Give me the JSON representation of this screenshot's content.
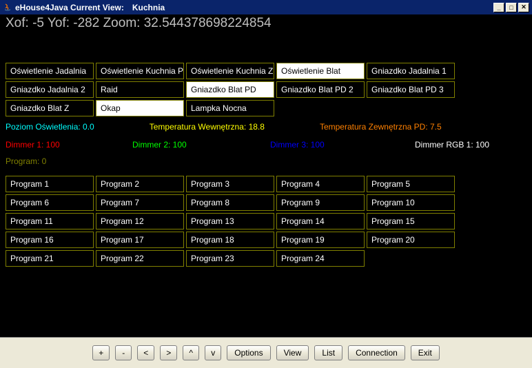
{
  "titlebar": {
    "app": "eHouse4Java Current View:",
    "view": "Kuchnia"
  },
  "coords": {
    "xof": -5,
    "yof": -282,
    "zoom": 32.544378698224854
  },
  "devices": [
    {
      "label": "Oświetlenie Jadalnia",
      "active": false
    },
    {
      "label": "Oświetlenie Kuchnia PD",
      "active": false
    },
    {
      "label": "Oświetlenie Kuchnia  Z",
      "active": false
    },
    {
      "label": "Oświetlenie Blat",
      "active": true
    },
    {
      "label": "Gniazdko Jadalnia 1",
      "active": false
    },
    {
      "label": "Gniazdko Jadalnia 2",
      "active": false
    },
    {
      "label": "Raid",
      "active": false
    },
    {
      "label": "Gniazdko Blat PD",
      "active": true
    },
    {
      "label": "Gniazdko Blat PD 2",
      "active": false
    },
    {
      "label": "Gniazdko Blat PD 3",
      "active": false
    },
    {
      "label": "Gniazdko Blat Z",
      "active": false
    },
    {
      "label": "Okap",
      "active": true
    },
    {
      "label": "Lampka Nocna",
      "active": false
    }
  ],
  "status": {
    "light_level": "Poziom Oświetlenia: 0.0",
    "temp_in": "Temperatura Wewnętrzna: 18.8",
    "temp_out": "Temperatura Zewnętrzna PD: 7.5"
  },
  "dimmers": {
    "d1": "Dimmer 1: 100",
    "d2": "Dimmer 2: 100",
    "d3": "Dimmer 3: 100",
    "rgb": "Dimmer RGB 1: 100"
  },
  "program_label": "Program: 0",
  "programs": [
    "Program 1",
    "Program 2",
    "Program 3",
    "Program 4",
    "Program 5",
    "Program 6",
    "Program 7",
    "Program 8",
    "Program 9",
    "Program 10",
    "Program 11",
    "Program 12",
    "Program 13",
    "Program 14",
    "Program 15",
    "Program 16",
    "Program 17",
    "Program 18",
    "Program 19",
    "Program 20",
    "Program 21",
    "Program 22",
    "Program 23",
    "Program 24"
  ],
  "bottom": {
    "plus": "+",
    "minus": "-",
    "left": "<",
    "right": ">",
    "up": "^",
    "down": "v",
    "options": "Options",
    "view": "View",
    "list": "List",
    "connection": "Connection",
    "exit": "Exit"
  }
}
